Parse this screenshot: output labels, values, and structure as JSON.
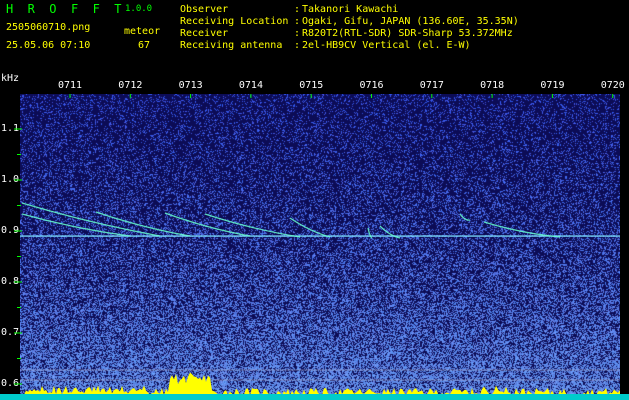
{
  "header": {
    "app_title": "H R O F F T",
    "app_version": "1.0.0",
    "file_name": "2505060710.png",
    "timestamp": "25.05.06 07:10",
    "meteor_label": "meteor",
    "meteor_count": "67"
  },
  "station": [
    {
      "key": "Observer",
      "value": "Takanori Kawachi"
    },
    {
      "key": "Receiving Location",
      "value": "Ogaki, Gifu, JAPAN (136.60E, 35.35N)"
    },
    {
      "key": "Receiver",
      "value": "R820T2(RTL-SDR) SDR-Sharp 53.372MHz"
    },
    {
      "key": "Receiving antenna",
      "value": "2el-HB9CV Vertical (el. E-W)"
    }
  ],
  "spectrogram": {
    "y_unit": "kHz",
    "x_ticks": [
      "0711",
      "0712",
      "0713",
      "0714",
      "0715",
      "0716",
      "0717",
      "0718",
      "0719",
      "0720"
    ],
    "y_ticks": [
      "1.1",
      "1.0",
      "0.9",
      "0.8",
      "0.7",
      "0.6"
    ],
    "carrier_khz": 0.89,
    "colors": {
      "background": "#0c0c56",
      "noise": "#3d66d6",
      "carrier": "#7fe0ff",
      "trail": "#66ffcc",
      "tick_marks": "#00ff00",
      "histogram": "#ffff00",
      "baseline": "#00cccc"
    }
  }
}
